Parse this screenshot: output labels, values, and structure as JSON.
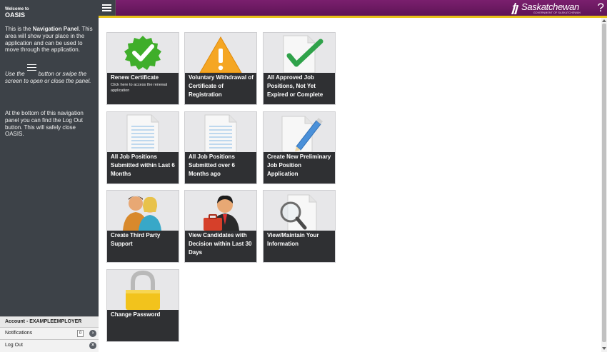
{
  "sidebar": {
    "welcome": "Welcome to",
    "app_name": "OASIS",
    "para1_a": "This is the ",
    "para1_b": "Navigation Panel",
    "para1_c": ". This area will show your place in the application and can be used to move through the application.",
    "para2_a": "Use the",
    "para2_b": "button or swipe the screen to open or close the panel.",
    "para3": "At the bottom of this navigation panel you can find the Log Out button. This will safely close OASIS.",
    "account": "Account - EXAMPLEEMPLOYER",
    "notifications_label": "Notifications",
    "notifications_count": "0",
    "logout_label": "Log Out"
  },
  "header": {
    "brand": "Saskatchewan",
    "brand_sub": "GOVERNMENT OF SASKATCHEWAN",
    "help": "?"
  },
  "tiles": [
    {
      "title": "Renew Certificate",
      "desc": "Click here to access the renewal application"
    },
    {
      "title": "Voluntary Withdrawal of Certificate of Registration"
    },
    {
      "title": "All Approved Job Positions, Not Yet Expired or Complete"
    },
    {
      "title": "All Job Positions Submitted within Last 6 Months"
    },
    {
      "title": "All Job Positions Submitted over 6 Months ago"
    },
    {
      "title": "Create New Preliminary Job Position Application"
    },
    {
      "title": "Create Third Party Support"
    },
    {
      "title": "View Candidates with Decision within Last 30 Days"
    },
    {
      "title": "View/Maintain Your Information"
    },
    {
      "title": "Change Password"
    }
  ],
  "icons": {
    "renew": "checkmark-badge-icon",
    "withdrawal": "warning-icon",
    "approved": "document-check-icon",
    "within6": "document-icon",
    "over6": "document-icon",
    "create_new": "document-pen-icon",
    "third_party": "people-icon",
    "candidates": "person-briefcase-icon",
    "maintain": "magnifier-document-icon",
    "password": "padlock-icon"
  },
  "colors": {
    "header": "#6b1862",
    "accent": "#e8c21a",
    "sidebar": "#3d4248",
    "tile_label": "#2f3033"
  }
}
